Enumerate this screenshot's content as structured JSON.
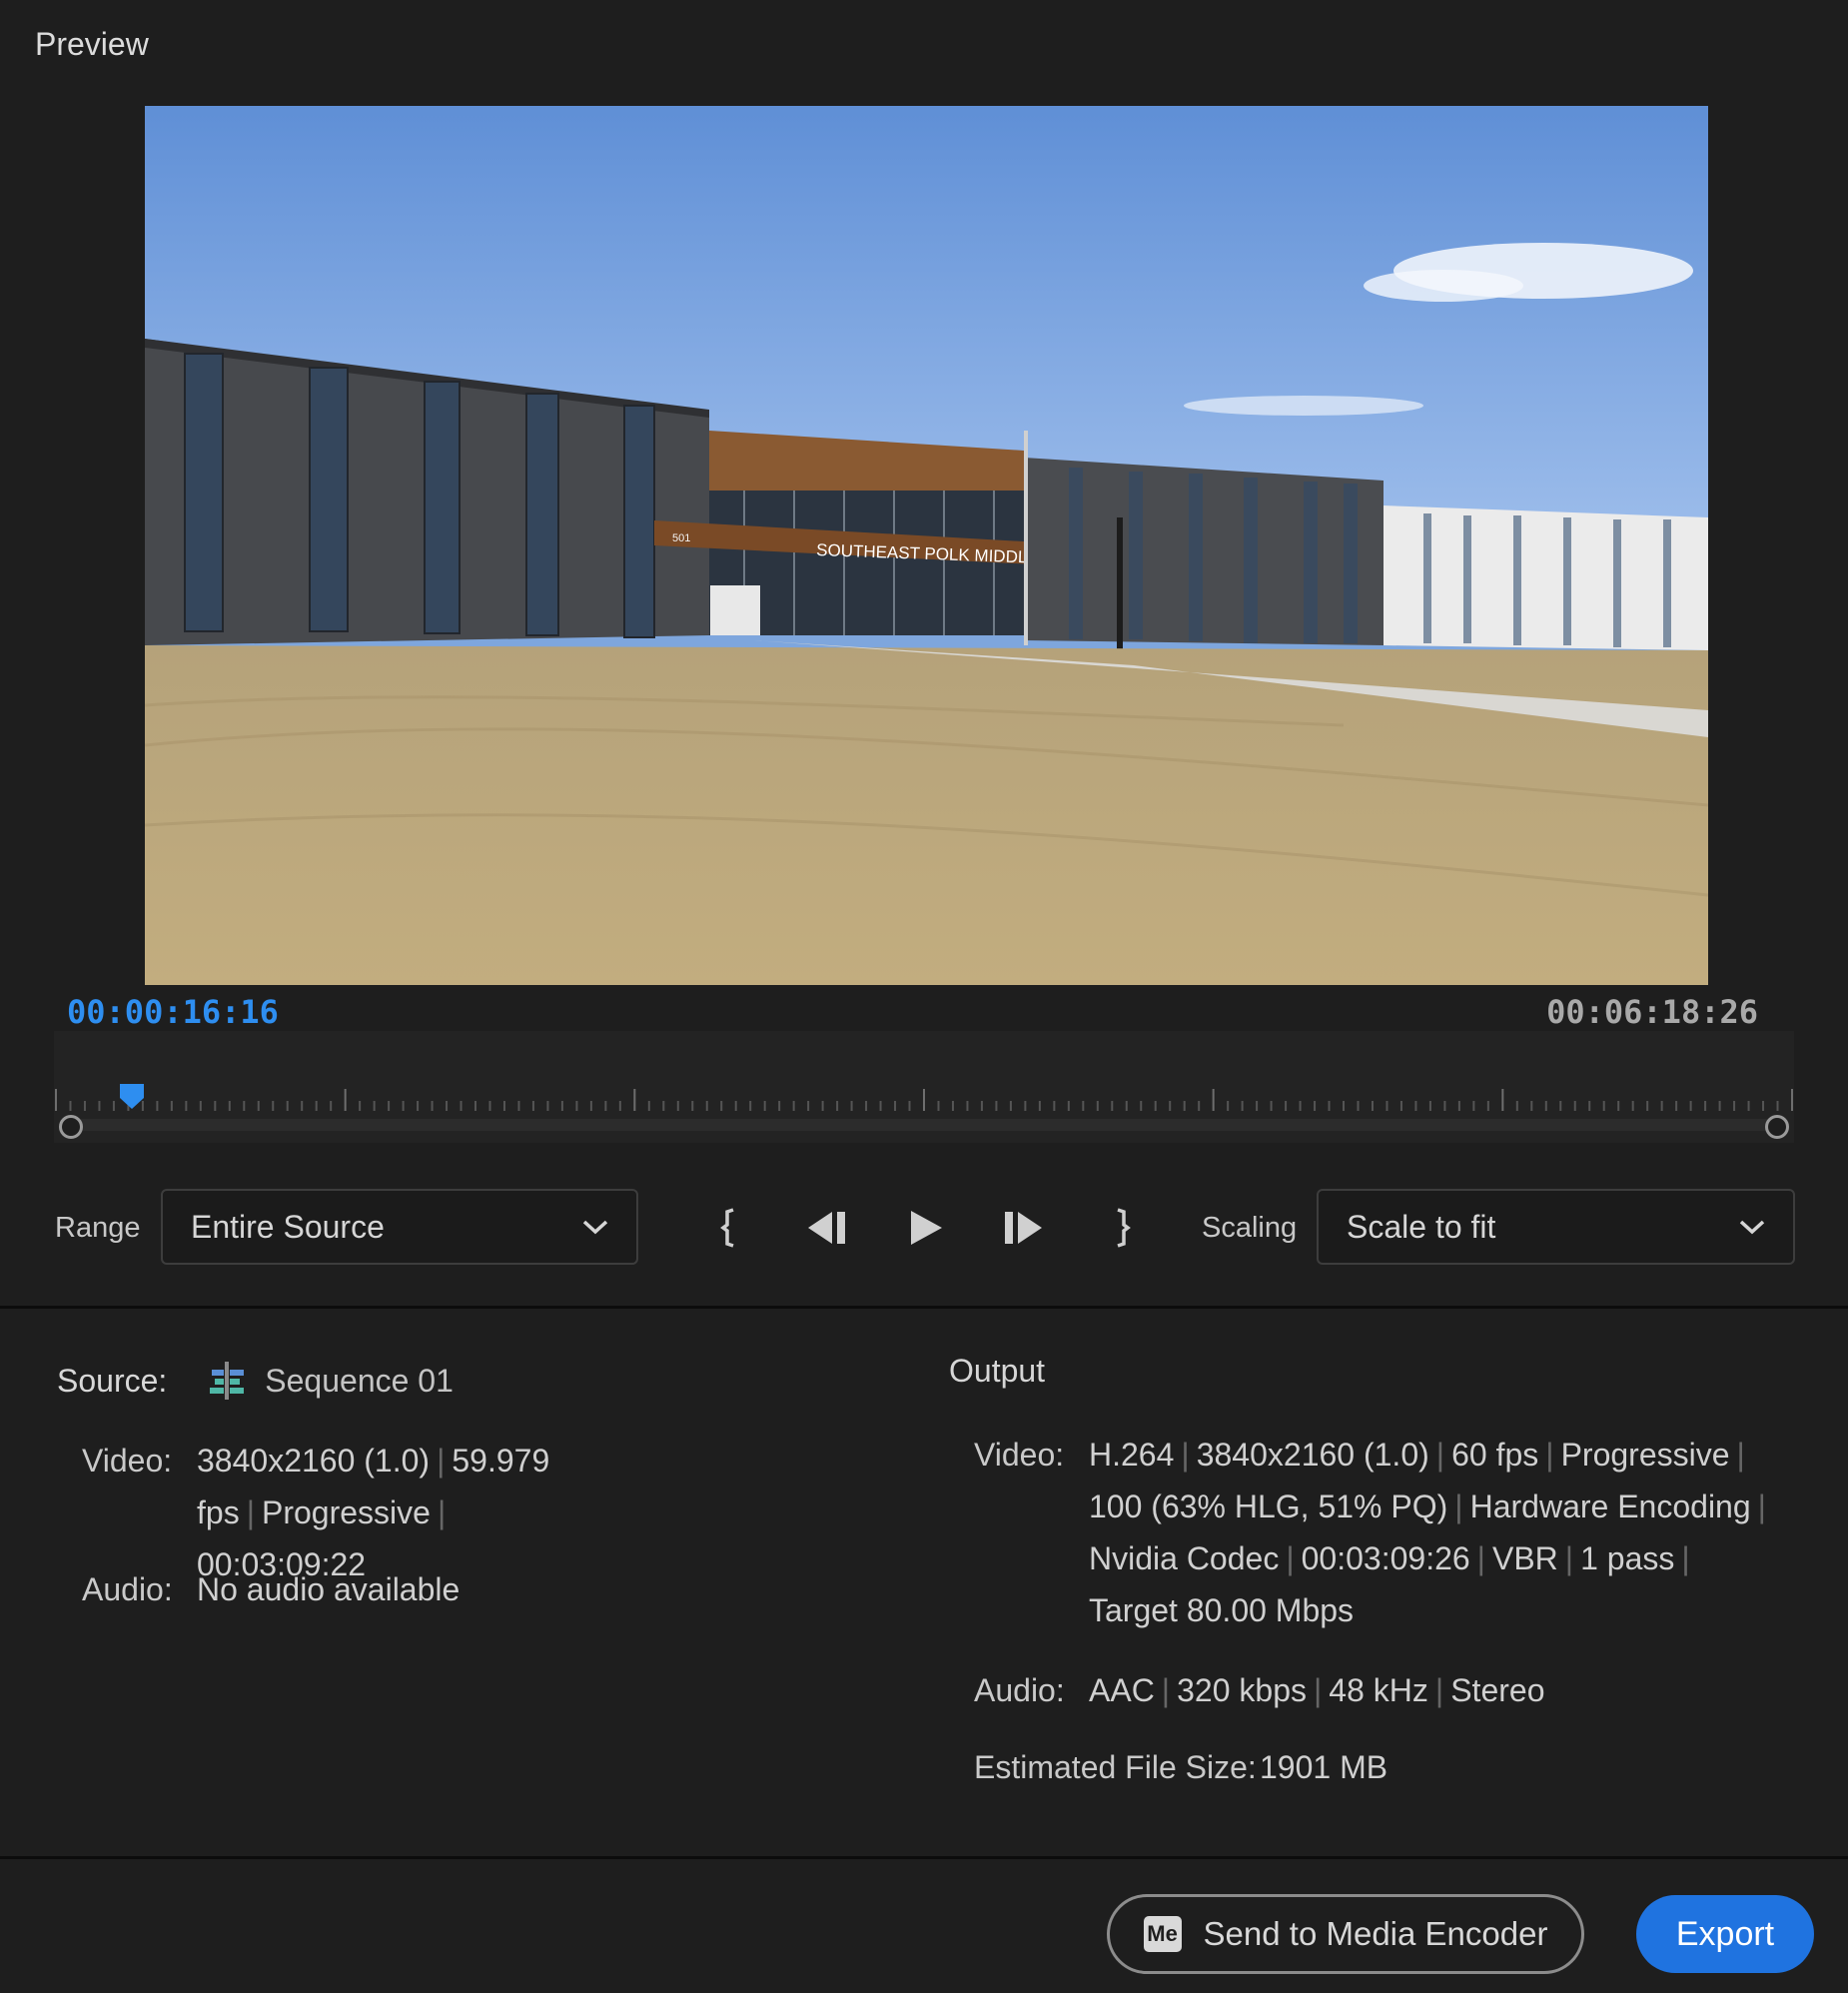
{
  "panel": {
    "title": "Preview"
  },
  "playback": {
    "current_time": "00:00:16:16",
    "duration": "00:06:18:26",
    "playhead_fraction": 0.044
  },
  "preview_image": {
    "sign_text": "SOUTHEAST POLK MIDDLE SCHOOL",
    "building_number": "501"
  },
  "controls": {
    "range_label": "Range",
    "range_value": "Entire Source",
    "scaling_label": "Scaling",
    "scaling_value": "Scale to fit"
  },
  "source": {
    "heading": "Source:",
    "name": "Sequence 01",
    "video_key": "Video:",
    "video": [
      "3840x2160 (1.0)",
      "59.979 fps",
      "Progressive",
      "00:03:09:22"
    ],
    "audio_key": "Audio:",
    "audio": "No audio available"
  },
  "output": {
    "heading": "Output",
    "video_key": "Video:",
    "video": [
      "H.264",
      "3840x2160 (1.0)",
      "60 fps",
      "Progressive",
      "100 (63% HLG, 51% PQ)",
      "Hardware Encoding",
      "Nvidia Codec",
      "00:03:09:26",
      "VBR",
      "1 pass",
      "Target 80.00 Mbps"
    ],
    "audio_key": "Audio:",
    "audio": [
      "AAC",
      "320 kbps",
      "48 kHz",
      "Stereo"
    ],
    "est_size_key": "Estimated File Size:",
    "est_size_value": "1901 MB"
  },
  "buttons": {
    "send_logo": "Me",
    "send_label": "Send to Media Encoder",
    "export_label": "Export"
  },
  "colors": {
    "accent": "#1f73e0",
    "timecode_blue": "#2e8ef0",
    "playhead": "#2e8ef0"
  },
  "icons": [
    "sequence-icon",
    "chevron-down-icon",
    "mark-in-icon",
    "step-back-icon",
    "play-icon",
    "step-forward-icon",
    "mark-out-icon",
    "playhead-icon"
  ]
}
